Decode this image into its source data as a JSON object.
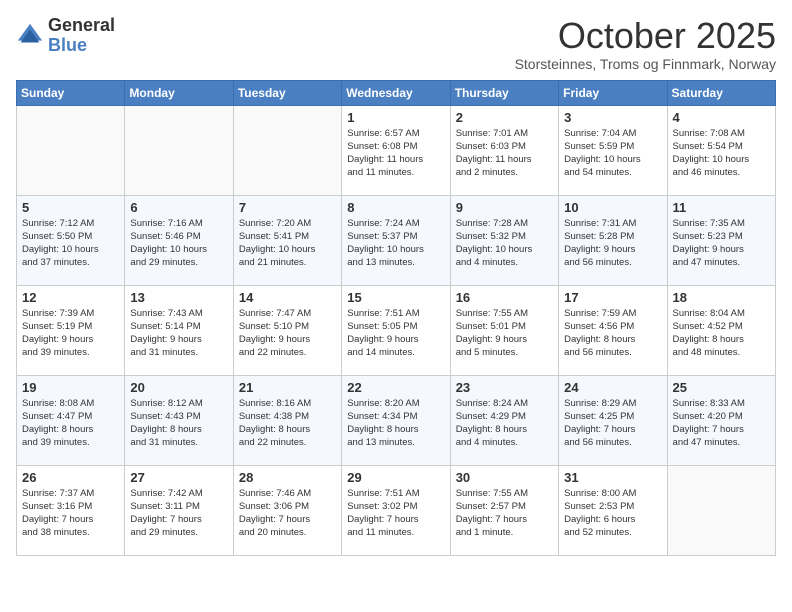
{
  "logo": {
    "general": "General",
    "blue": "Blue"
  },
  "title": "October 2025",
  "location": "Storsteinnes, Troms og Finnmark, Norway",
  "weekdays": [
    "Sunday",
    "Monday",
    "Tuesday",
    "Wednesday",
    "Thursday",
    "Friday",
    "Saturday"
  ],
  "weeks": [
    [
      {
        "day": "",
        "info": ""
      },
      {
        "day": "",
        "info": ""
      },
      {
        "day": "",
        "info": ""
      },
      {
        "day": "1",
        "info": "Sunrise: 6:57 AM\nSunset: 6:08 PM\nDaylight: 11 hours\nand 11 minutes."
      },
      {
        "day": "2",
        "info": "Sunrise: 7:01 AM\nSunset: 6:03 PM\nDaylight: 11 hours\nand 2 minutes."
      },
      {
        "day": "3",
        "info": "Sunrise: 7:04 AM\nSunset: 5:59 PM\nDaylight: 10 hours\nand 54 minutes."
      },
      {
        "day": "4",
        "info": "Sunrise: 7:08 AM\nSunset: 5:54 PM\nDaylight: 10 hours\nand 46 minutes."
      }
    ],
    [
      {
        "day": "5",
        "info": "Sunrise: 7:12 AM\nSunset: 5:50 PM\nDaylight: 10 hours\nand 37 minutes."
      },
      {
        "day": "6",
        "info": "Sunrise: 7:16 AM\nSunset: 5:46 PM\nDaylight: 10 hours\nand 29 minutes."
      },
      {
        "day": "7",
        "info": "Sunrise: 7:20 AM\nSunset: 5:41 PM\nDaylight: 10 hours\nand 21 minutes."
      },
      {
        "day": "8",
        "info": "Sunrise: 7:24 AM\nSunset: 5:37 PM\nDaylight: 10 hours\nand 13 minutes."
      },
      {
        "day": "9",
        "info": "Sunrise: 7:28 AM\nSunset: 5:32 PM\nDaylight: 10 hours\nand 4 minutes."
      },
      {
        "day": "10",
        "info": "Sunrise: 7:31 AM\nSunset: 5:28 PM\nDaylight: 9 hours\nand 56 minutes."
      },
      {
        "day": "11",
        "info": "Sunrise: 7:35 AM\nSunset: 5:23 PM\nDaylight: 9 hours\nand 47 minutes."
      }
    ],
    [
      {
        "day": "12",
        "info": "Sunrise: 7:39 AM\nSunset: 5:19 PM\nDaylight: 9 hours\nand 39 minutes."
      },
      {
        "day": "13",
        "info": "Sunrise: 7:43 AM\nSunset: 5:14 PM\nDaylight: 9 hours\nand 31 minutes."
      },
      {
        "day": "14",
        "info": "Sunrise: 7:47 AM\nSunset: 5:10 PM\nDaylight: 9 hours\nand 22 minutes."
      },
      {
        "day": "15",
        "info": "Sunrise: 7:51 AM\nSunset: 5:05 PM\nDaylight: 9 hours\nand 14 minutes."
      },
      {
        "day": "16",
        "info": "Sunrise: 7:55 AM\nSunset: 5:01 PM\nDaylight: 9 hours\nand 5 minutes."
      },
      {
        "day": "17",
        "info": "Sunrise: 7:59 AM\nSunset: 4:56 PM\nDaylight: 8 hours\nand 56 minutes."
      },
      {
        "day": "18",
        "info": "Sunrise: 8:04 AM\nSunset: 4:52 PM\nDaylight: 8 hours\nand 48 minutes."
      }
    ],
    [
      {
        "day": "19",
        "info": "Sunrise: 8:08 AM\nSunset: 4:47 PM\nDaylight: 8 hours\nand 39 minutes."
      },
      {
        "day": "20",
        "info": "Sunrise: 8:12 AM\nSunset: 4:43 PM\nDaylight: 8 hours\nand 31 minutes."
      },
      {
        "day": "21",
        "info": "Sunrise: 8:16 AM\nSunset: 4:38 PM\nDaylight: 8 hours\nand 22 minutes."
      },
      {
        "day": "22",
        "info": "Sunrise: 8:20 AM\nSunset: 4:34 PM\nDaylight: 8 hours\nand 13 minutes."
      },
      {
        "day": "23",
        "info": "Sunrise: 8:24 AM\nSunset: 4:29 PM\nDaylight: 8 hours\nand 4 minutes."
      },
      {
        "day": "24",
        "info": "Sunrise: 8:29 AM\nSunset: 4:25 PM\nDaylight: 7 hours\nand 56 minutes."
      },
      {
        "day": "25",
        "info": "Sunrise: 8:33 AM\nSunset: 4:20 PM\nDaylight: 7 hours\nand 47 minutes."
      }
    ],
    [
      {
        "day": "26",
        "info": "Sunrise: 7:37 AM\nSunset: 3:16 PM\nDaylight: 7 hours\nand 38 minutes."
      },
      {
        "day": "27",
        "info": "Sunrise: 7:42 AM\nSunset: 3:11 PM\nDaylight: 7 hours\nand 29 minutes."
      },
      {
        "day": "28",
        "info": "Sunrise: 7:46 AM\nSunset: 3:06 PM\nDaylight: 7 hours\nand 20 minutes."
      },
      {
        "day": "29",
        "info": "Sunrise: 7:51 AM\nSunset: 3:02 PM\nDaylight: 7 hours\nand 11 minutes."
      },
      {
        "day": "30",
        "info": "Sunrise: 7:55 AM\nSunset: 2:57 PM\nDaylight: 7 hours\nand 1 minute."
      },
      {
        "day": "31",
        "info": "Sunrise: 8:00 AM\nSunset: 2:53 PM\nDaylight: 6 hours\nand 52 minutes."
      },
      {
        "day": "",
        "info": ""
      }
    ]
  ]
}
